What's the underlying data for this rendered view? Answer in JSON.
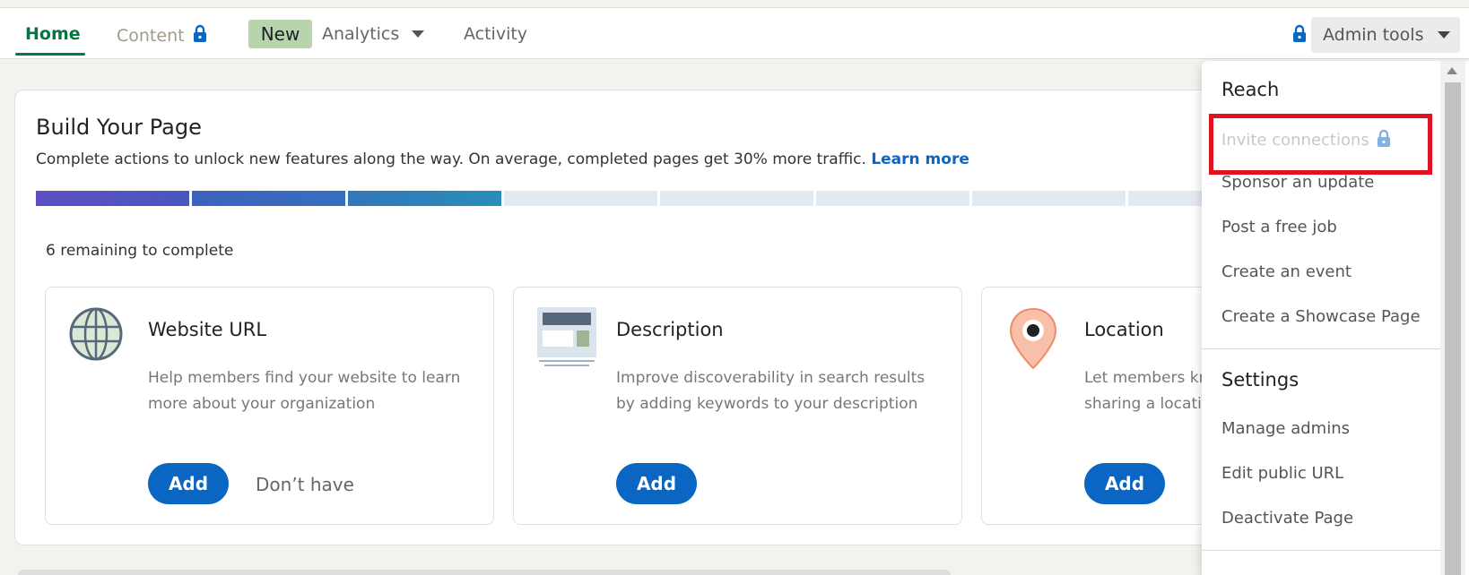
{
  "nav": {
    "home": "Home",
    "content": "Content",
    "new_badge": "New",
    "analytics": "Analytics",
    "activity": "Activity",
    "admin_tools": "Admin tools"
  },
  "build_card": {
    "title": "Build Your Page",
    "subtitle": "Complete actions to unlock new features along the way. On average, completed pages get 30% more traffic.",
    "learn_more": "Learn more",
    "progress": {
      "completed_segments": 3,
      "total_segments": 9
    },
    "remaining": "6 remaining to complete"
  },
  "items": [
    {
      "title": "Website URL",
      "description": "Help members find your website to learn more about your organization",
      "add": "Add",
      "dont_have": "Don’t have",
      "icon": "globe-icon"
    },
    {
      "title": "Description",
      "description": "Improve discoverability in search results by adding keywords to your description",
      "add": "Add",
      "icon": "description-icon"
    },
    {
      "title": "Location",
      "description": "Let members know where you are by sharing a location",
      "add": "Add",
      "icon": "location-pin-icon"
    }
  ],
  "dropdown": {
    "reach_header": "Reach",
    "reach_items": [
      "Invite connections",
      "Sponsor an update",
      "Post a free job",
      "Create an event",
      "Create a Showcase Page"
    ],
    "settings_header": "Settings",
    "settings_items": [
      "Manage admins",
      "Edit public URL",
      "Deactivate Page"
    ]
  },
  "colors": {
    "brand_green": "#057642",
    "brand_blue": "#0a66c2",
    "highlight_red": "#e0121f"
  }
}
